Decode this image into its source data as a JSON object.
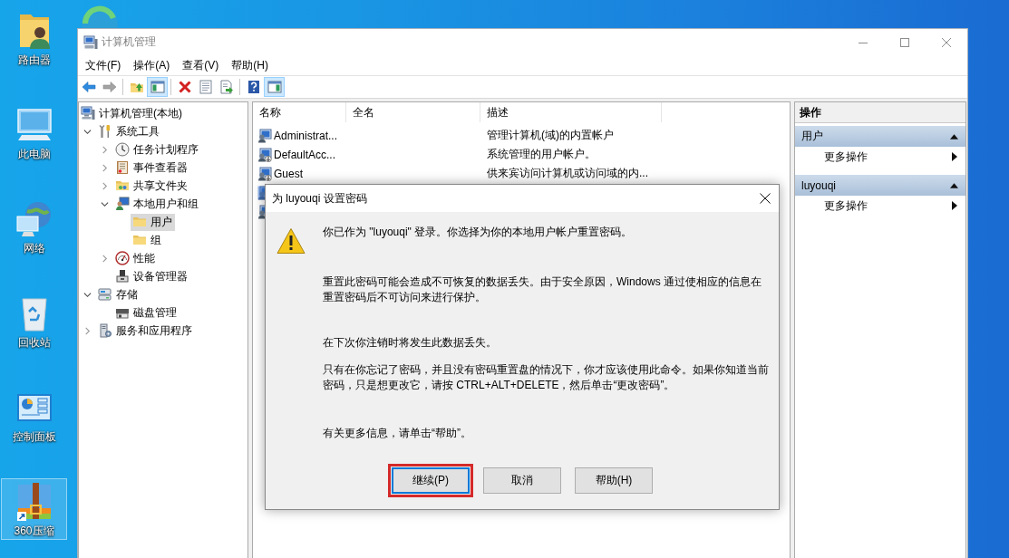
{
  "desktop_icons": [
    {
      "label": "路由器",
      "selected": false
    },
    {
      "label": "此电脑",
      "selected": false
    },
    {
      "label": "网络",
      "selected": false
    },
    {
      "label": "回收站",
      "selected": false
    },
    {
      "label": "控制面板",
      "selected": false
    },
    {
      "label": "360压缩",
      "selected": true
    }
  ],
  "window": {
    "title": "计算机管理"
  },
  "menu": [
    "文件(F)",
    "操作(A)",
    "查看(V)",
    "帮助(H)"
  ],
  "toolbar": [
    [
      {
        "pressed": false,
        "disabled": false
      },
      {
        "pressed": false,
        "disabled": true
      }
    ],
    [
      {
        "pressed": false,
        "disabled": false
      },
      {
        "pressed": true,
        "disabled": false
      }
    ],
    [
      {
        "pressed": false,
        "disabled": false
      },
      {
        "pressed": false,
        "disabled": false
      },
      {
        "pressed": false,
        "disabled": false
      }
    ],
    [
      {
        "pressed": false,
        "disabled": false
      },
      {
        "pressed": true,
        "disabled": false
      }
    ]
  ],
  "tree": [
    {
      "label": "计算机管理(本地)",
      "selected": false,
      "children": [
        {
          "label": "系统工具",
          "expanded": true,
          "selected": false,
          "children": [
            {
              "label": "任务计划程序",
              "expanded": false,
              "selected": false
            },
            {
              "label": "事件查看器",
              "expanded": false,
              "selected": false
            },
            {
              "label": "共享文件夹",
              "expanded": false,
              "selected": false
            },
            {
              "label": "本地用户和组",
              "expanded": true,
              "selected": false,
              "children": [
                {
                  "label": "用户",
                  "selected": true
                },
                {
                  "label": "组",
                  "selected": false
                }
              ]
            },
            {
              "label": "性能",
              "expanded": false,
              "selected": false
            },
            {
              "label": "设备管理器",
              "selected": false
            }
          ]
        },
        {
          "label": "存储",
          "expanded": true,
          "selected": false,
          "children": [
            {
              "label": "磁盘管理",
              "selected": false
            }
          ]
        },
        {
          "label": "服务和应用程序",
          "expanded": false,
          "selected": false
        }
      ]
    }
  ],
  "list": {
    "columns": [
      "名称",
      "全名",
      "描述"
    ],
    "rows": [
      {
        "name": "Administrat...",
        "description": "管理计算机(域)的内置帐户",
        "disabled": false,
        "selected": false
      },
      {
        "name": "DefaultAcc...",
        "description": "系统管理的用户帐户。",
        "disabled": true,
        "selected": false
      },
      {
        "name": "Guest",
        "description": "供来宾访问计算机或访问域的内...",
        "disabled": true,
        "selected": false
      },
      {
        "selected": true
      },
      {
        "selected": false
      }
    ]
  },
  "actions": {
    "title": "操作",
    "sections": [
      {
        "label": "用户",
        "expanded": true,
        "items": [
          "更多操作"
        ]
      },
      {
        "label": "luyouqi",
        "expanded": true,
        "items": [
          "更多操作"
        ]
      }
    ]
  },
  "dialog": {
    "title": "为 luyouqi 设置密码",
    "messages": [
      "你已作为 \"luyouqi\" 登录。你选择为你的本地用户帐户重置密码。",
      "重置此密码可能会造成不可恢复的数据丢失。由于安全原因，Windows 通过使相应的信息在重置密码后不可访问来进行保护。",
      "在下次你注销时将发生此数据丢失。",
      "只有在你忘记了密码，并且没有密码重置盘的情况下，你才应该使用此命令。如果你知道当前密码，只是想更改它，请按 CTRL+ALT+DELETE，然后单击“更改密码”。",
      "有关更多信息，请单击“帮助”。"
    ],
    "buttons": [
      {
        "label": "继续(P)",
        "default": true,
        "highlighted": true
      },
      {
        "label": "取消",
        "default": false,
        "highlighted": false
      },
      {
        "label": "帮助(H)",
        "default": false,
        "highlighted": false
      }
    ]
  }
}
